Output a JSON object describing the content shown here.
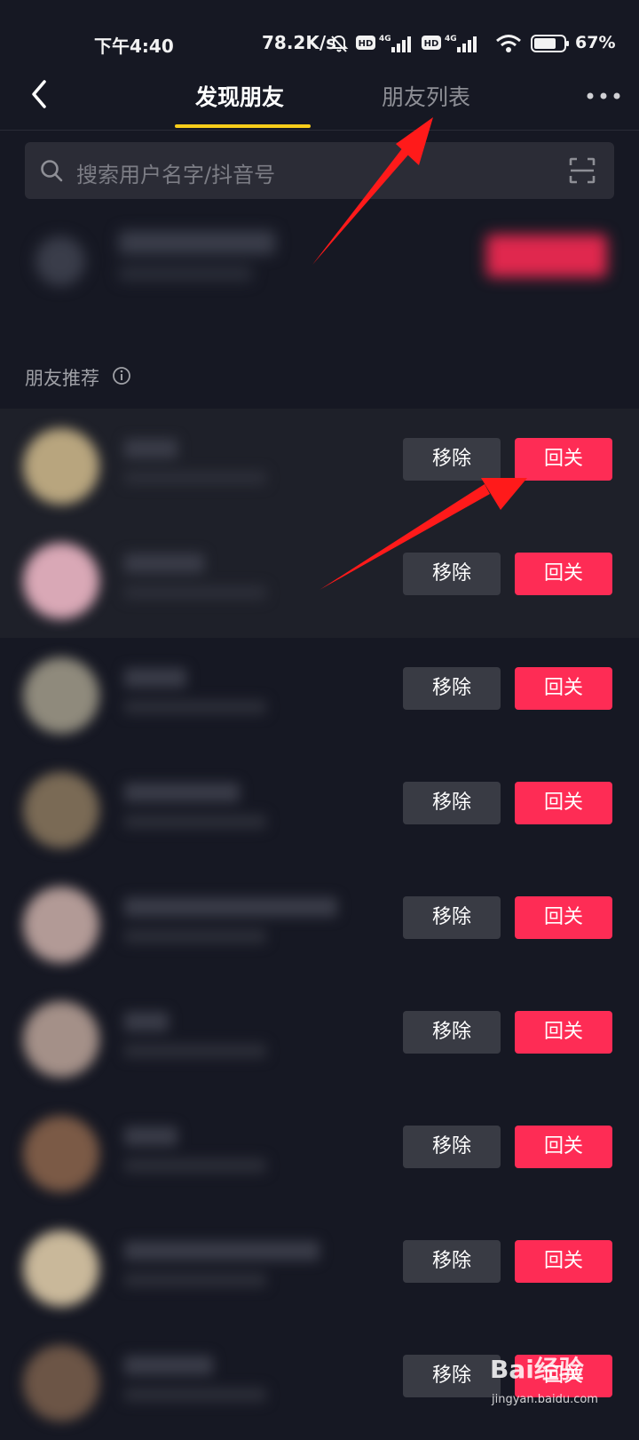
{
  "status_bar": {
    "time": "下午4:40",
    "net_speed": "78.2K/s",
    "battery": "67%",
    "icons": [
      "mute-bell-icon",
      "hd-icon",
      "signal-4g-icon",
      "hd-icon",
      "signal-4g-icon",
      "wifi-icon",
      "battery-icon"
    ]
  },
  "nav": {
    "back_icon": "back-arrow-icon",
    "tab_active": "发现朋友",
    "tab_inactive": "朋友列表",
    "more_icon": "more-dots-icon",
    "accent_color": "#f8cd1a"
  },
  "search": {
    "placeholder": "搜索用户名字/抖音号",
    "icon": "search-icon",
    "scan_icon": "scan-icon"
  },
  "section": {
    "title": "朋友推荐",
    "info_icon": "info-icon"
  },
  "rows": [
    {
      "remove": "移除",
      "follow": "回关",
      "avatar_color": "#b8a57e",
      "highlighted": true
    },
    {
      "remove": "移除",
      "follow": "回关",
      "avatar_color": "#d9a8b6",
      "highlighted": true
    },
    {
      "remove": "移除",
      "follow": "回关",
      "avatar_color": "#8f8a7c",
      "highlighted": false
    },
    {
      "remove": "移除",
      "follow": "回关",
      "avatar_color": "#7a6a55",
      "highlighted": false
    },
    {
      "remove": "移除",
      "follow": "回关",
      "avatar_color": "#b29a96",
      "highlighted": false
    },
    {
      "remove": "移除",
      "follow": "回关",
      "avatar_color": "#a49088",
      "highlighted": false
    },
    {
      "remove": "移除",
      "follow": "回关",
      "avatar_color": "#7b5a46",
      "highlighted": false
    },
    {
      "remove": "移除",
      "follow": "回关",
      "avatar_color": "#c9b89a",
      "highlighted": false
    },
    {
      "remove": "移除",
      "follow": "回关",
      "avatar_color": "#6c5546",
      "highlighted": false
    }
  ],
  "colors": {
    "background": "#161823",
    "follow_button": "#fe2c55",
    "remove_button": "#393b44",
    "arrow": "#ff1a1a"
  },
  "watermark": {
    "brand": "Bai经验",
    "url": "jingyan.baidu.com"
  }
}
